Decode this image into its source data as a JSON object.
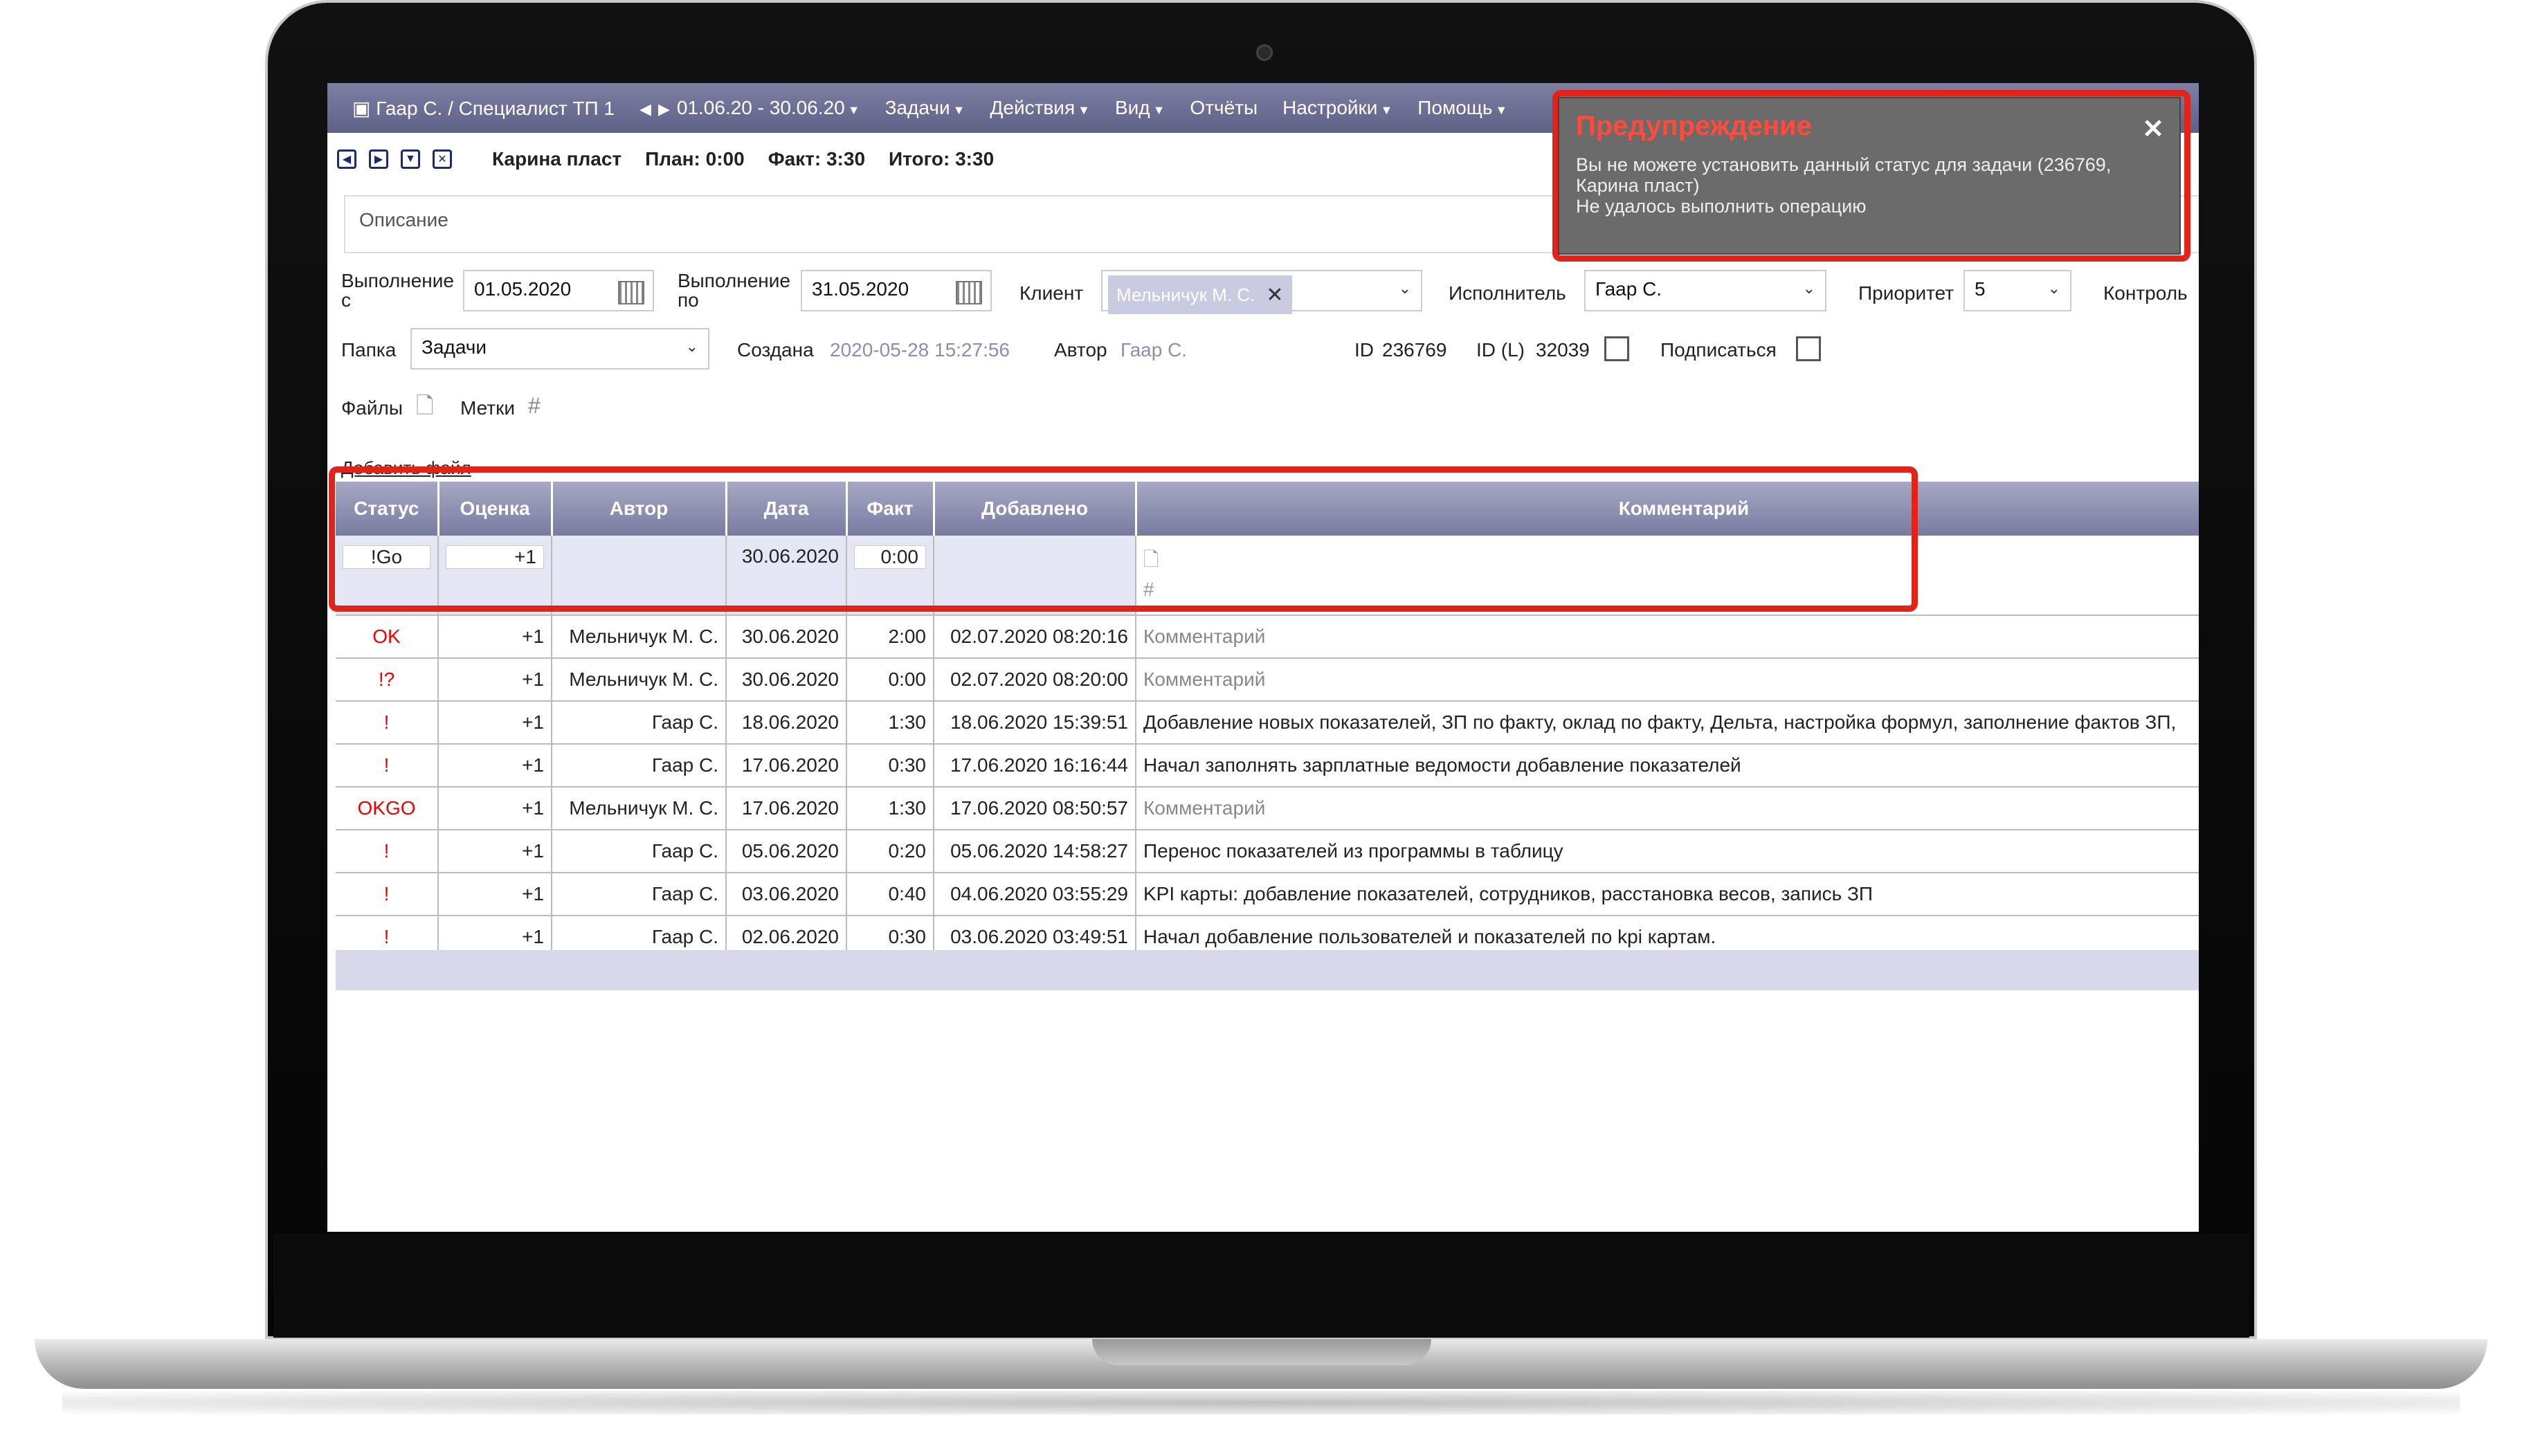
{
  "menubar": {
    "user": "Гаар С. / Специалист ТП 1",
    "period": "01.06.20 - 30.06.20",
    "items": [
      "Задачи",
      "Действия",
      "Вид",
      "Отчёты",
      "Настройки",
      "Помощь"
    ]
  },
  "toolbar": {
    "task_name": "Карина пласт",
    "plan": "План: 0:00",
    "fact": "Факт: 3:30",
    "total": "Итого: 3:30"
  },
  "description": {
    "placeholder": "Описание"
  },
  "form": {
    "exec_from_label": "Выполнение с",
    "exec_from": "01.05.2020",
    "exec_to_label": "Выполнение по",
    "exec_to": "31.05.2020",
    "client_label": "Клиент",
    "client": "Мельничук М. С.",
    "executor_label": "Исполнитель",
    "executor": "Гаар С.",
    "priority_label": "Приоритет",
    "priority": "5",
    "control_label": "Контроль",
    "folder_label": "Папка",
    "folder": "Задачи",
    "created_label": "Создана",
    "created": "2020-05-28 15:27:56",
    "author_label": "Автор",
    "author": "Гаар С.",
    "id_label": "ID",
    "id": "236769",
    "idl_label": "ID (L)",
    "idl": "32039",
    "subscribe_label": "Подписаться",
    "files_label": "Файлы",
    "tags_label": "Метки",
    "add_file": "Добавить файл"
  },
  "table": {
    "columns": [
      "Статус",
      "Оценка",
      "Автор",
      "Дата",
      "Факт",
      "Добавлено",
      "Комментарий"
    ],
    "edit_row": {
      "status": "!Go",
      "rating": "+1",
      "date": "30.06.2020",
      "fact": "0:00"
    },
    "rows": [
      {
        "status": "OK",
        "rating": "+1",
        "author": "Мельничук М. С.",
        "date": "30.06.2020",
        "fact": "2:00",
        "added": "02.07.2020 08:20:16",
        "comment": "Комментарий",
        "placeholder": true
      },
      {
        "status": "!?",
        "rating": "+1",
        "author": "Мельничук М. С.",
        "date": "30.06.2020",
        "fact": "0:00",
        "added": "02.07.2020 08:20:00",
        "comment": "Комментарий",
        "placeholder": true
      },
      {
        "status": "!",
        "rating": "+1",
        "author": "Гаар С.",
        "date": "18.06.2020",
        "fact": "1:30",
        "added": "18.06.2020 15:39:51",
        "comment": "Добавление новых показателей, ЗП по факту, оклад по факту, Дельта, настройка формул, заполнение фактов ЗП,",
        "placeholder": false
      },
      {
        "status": "!",
        "rating": "+1",
        "author": "Гаар С.",
        "date": "17.06.2020",
        "fact": "0:30",
        "added": "17.06.2020 16:16:44",
        "comment": "Начал заполнять зарплатные ведомости добавление показателей",
        "placeholder": false
      },
      {
        "status": "OKGO",
        "rating": "+1",
        "author": "Мельничук М. С.",
        "date": "17.06.2020",
        "fact": "1:30",
        "added": "17.06.2020 08:50:57",
        "comment": "Комментарий",
        "placeholder": true
      },
      {
        "status": "!",
        "rating": "+1",
        "author": "Гаар С.",
        "date": "05.06.2020",
        "fact": "0:20",
        "added": "05.06.2020 14:58:27",
        "comment": "Перенос показателей из программы в таблицу",
        "placeholder": false
      },
      {
        "status": "!",
        "rating": "+1",
        "author": "Гаар С.",
        "date": "03.06.2020",
        "fact": "0:40",
        "added": "04.06.2020 03:55:29",
        "comment": "KPI карты: добавление показателей, сотрудников, расстановка весов, запись ЗП",
        "placeholder": false
      },
      {
        "status": "!",
        "rating": "+1",
        "author": "Гаар С.",
        "date": "02.06.2020",
        "fact": "0:30",
        "added": "03.06.2020 03:49:51",
        "comment": "Начал добавление пользователей и показателей по kpi картам.",
        "placeholder": false
      }
    ]
  },
  "popup": {
    "title": "Предупреждение",
    "message": "Вы не можете установить данный статус для задачи (236769, Карина пласт)\nНе удалось выполнить операцию",
    "close": "✕"
  },
  "colors": {
    "accent": "#e2231a",
    "header": "#787ba0",
    "status_red": "#e00000"
  }
}
